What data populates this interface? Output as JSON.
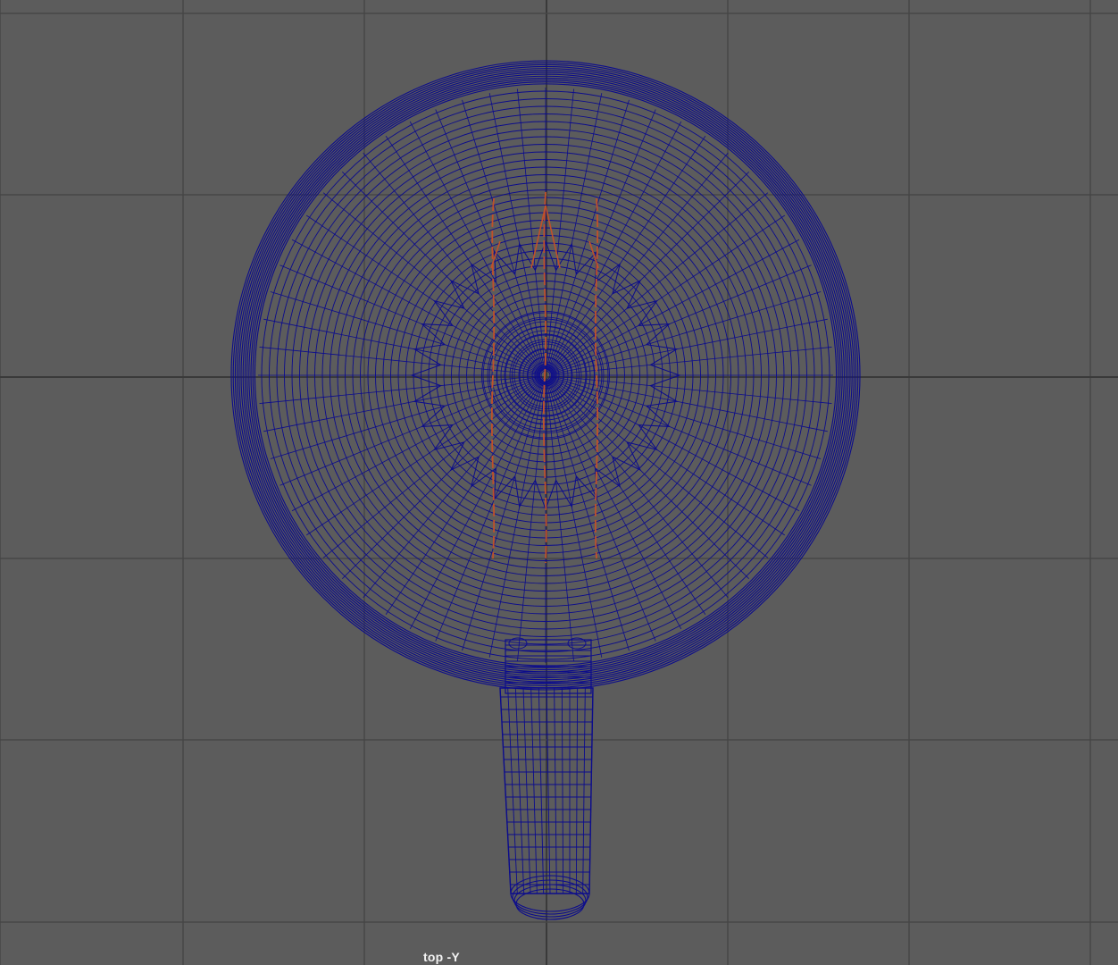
{
  "viewport": {
    "camera_label": "top -Y",
    "background_color": "#5c5c5c",
    "grid_color": "#464646",
    "axis_color": "#3a3a3a",
    "wireframe_color": "#0c0c8c",
    "curve_color": "#c0502a"
  },
  "scene_objects": [
    {
      "name": "pan-body",
      "type": "mesh",
      "display": "wireframe"
    },
    {
      "name": "pan-handle",
      "type": "mesh",
      "display": "wireframe"
    },
    {
      "name": "center-curves",
      "type": "curve"
    }
  ]
}
